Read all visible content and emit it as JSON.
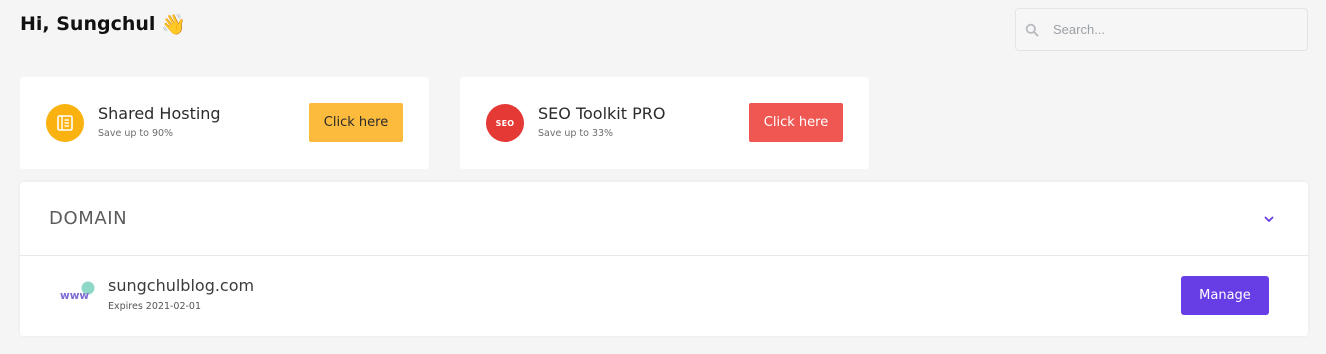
{
  "greeting": {
    "text": "Hi, Sungchul",
    "emoji": "👋"
  },
  "search": {
    "placeholder": "Search...",
    "value": "",
    "icon": "search-icon"
  },
  "promos": [
    {
      "title": "Shared Hosting",
      "subtitle": "Save up to 90%",
      "cta": "Click here",
      "icon": "server-icon",
      "accent": "#f9b20f",
      "button_color": "#fdbb3e"
    },
    {
      "title": "SEO Toolkit PRO",
      "subtitle": "Save up to 33%",
      "cta": "Click here",
      "icon": "seo-icon",
      "badge_text": "SEO",
      "accent": "#e53935",
      "button_color": "#ef5753"
    }
  ],
  "domain_section": {
    "title": "DOMAIN",
    "toggle_icon": "chevron-down-icon",
    "accent": "#673de6",
    "items": [
      {
        "name": "sungchulblog.com",
        "expiry": "Expires 2021-02-01",
        "action": "Manage",
        "icon": "www-icon"
      }
    ]
  }
}
